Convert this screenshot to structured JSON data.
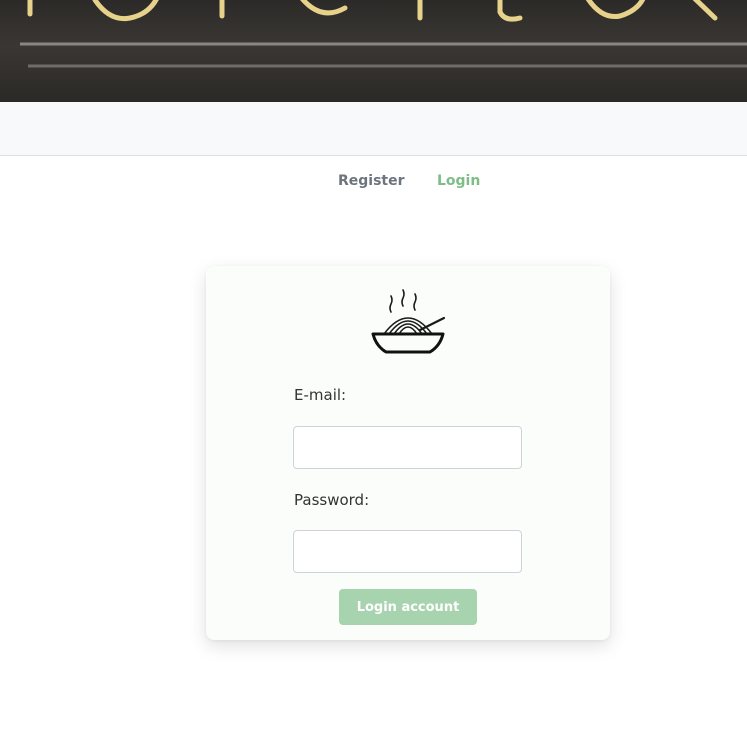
{
  "nav": {
    "register_label": "Register",
    "login_label": "Login"
  },
  "form": {
    "email_label": "E-mail:",
    "email_value": "",
    "password_label": "Password:",
    "password_value": "",
    "submit_label": "Login account"
  },
  "colors": {
    "accent": "#7dbd86",
    "button_bg": "#a8d3af",
    "banner_text": "#e8d48a"
  },
  "icons": {
    "logo": "noodle-bowl-icon"
  }
}
